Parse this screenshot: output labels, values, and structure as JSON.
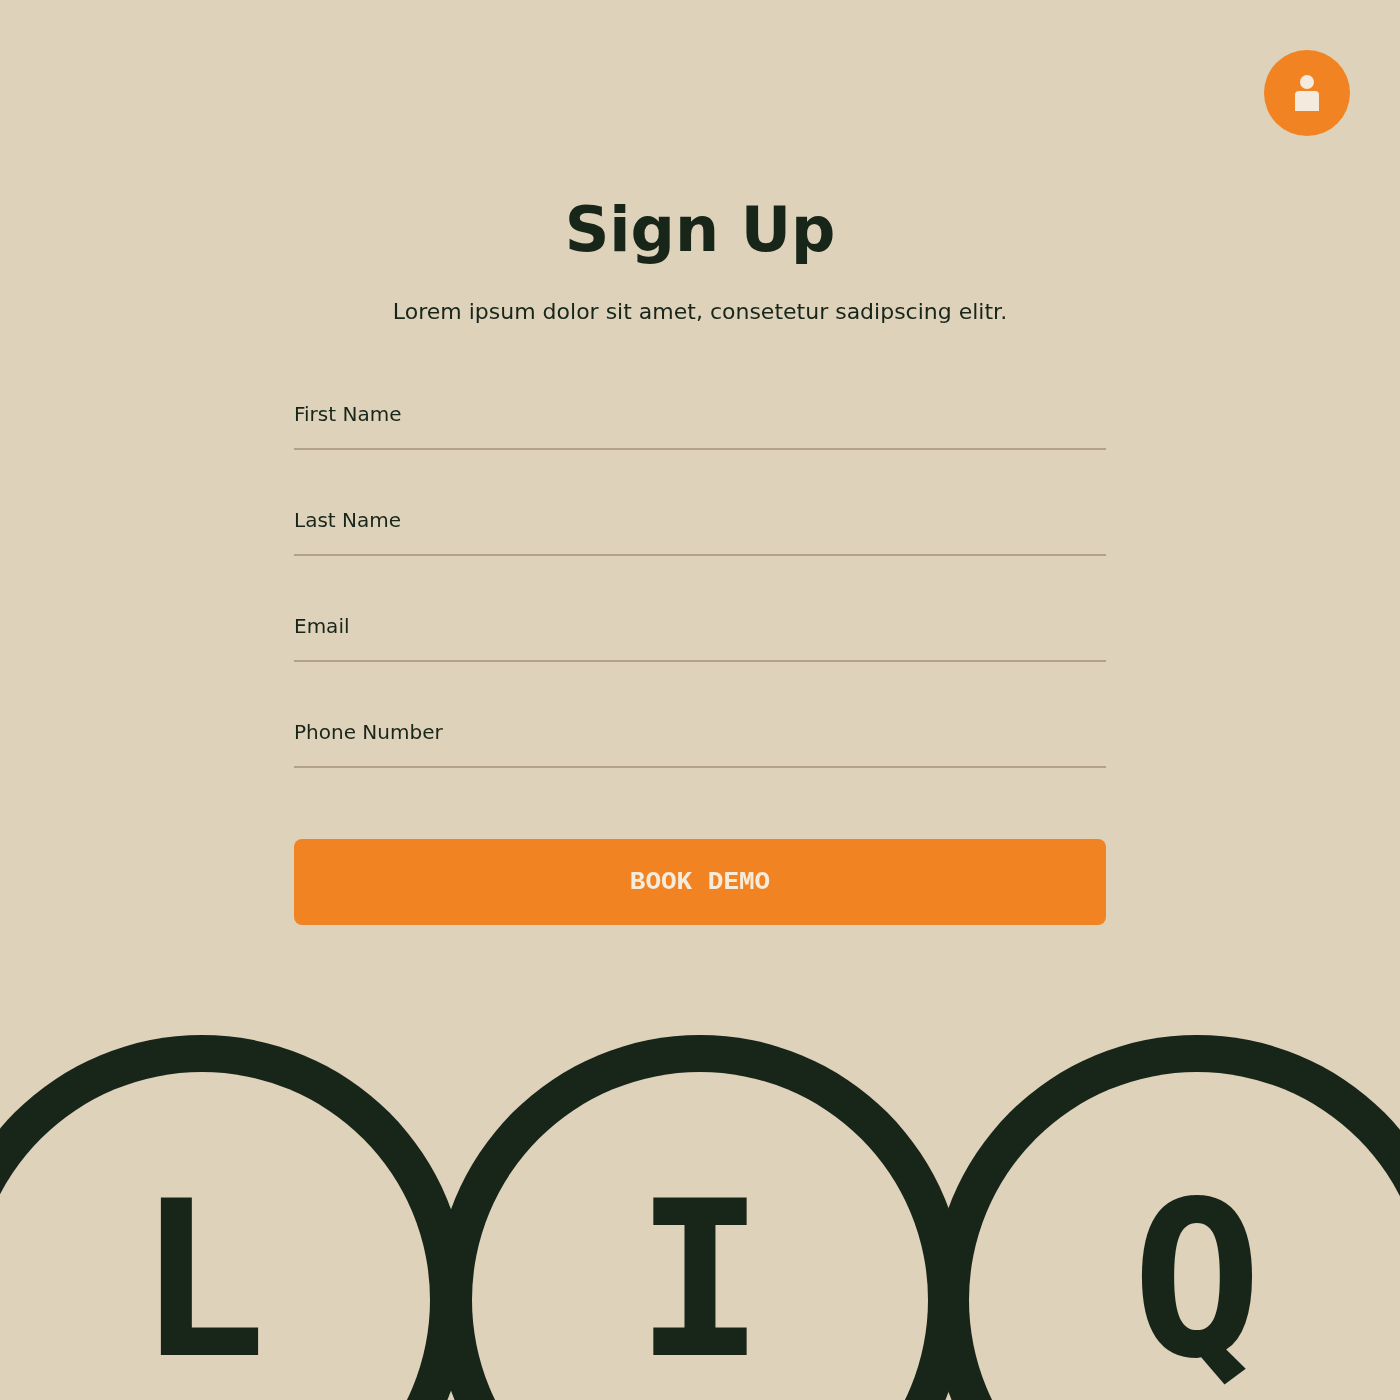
{
  "title": "Sign Up",
  "subtitle": "Lorem ipsum dolor sit amet, consetetur sadipscing elitr.",
  "fields": [
    {
      "placeholder": "First Name"
    },
    {
      "placeholder": "Last Name"
    },
    {
      "placeholder": "Email"
    },
    {
      "placeholder": "Phone Number"
    }
  ],
  "submit_button": {
    "label": "BOOK DEMO"
  },
  "logo": {
    "letters": [
      "L",
      "I",
      "Q"
    ]
  }
}
